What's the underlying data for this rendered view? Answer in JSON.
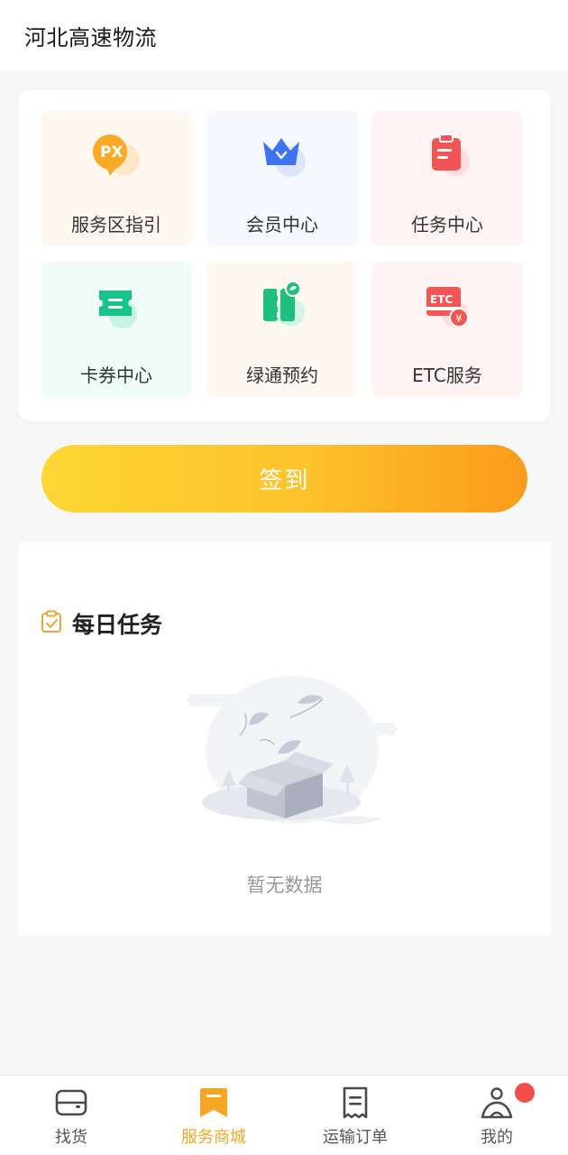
{
  "header": {
    "title": "河北高速物流"
  },
  "services": [
    {
      "label": "服务区指引",
      "icon": "px-location-icon"
    },
    {
      "label": "会员中心",
      "icon": "crown-icon"
    },
    {
      "label": "任务中心",
      "icon": "clipboard-icon"
    },
    {
      "label": "卡券中心",
      "icon": "ticket-icon"
    },
    {
      "label": "绿通预约",
      "icon": "green-road-icon"
    },
    {
      "label": "ETC服务",
      "icon": "etc-card-icon"
    }
  ],
  "checkin": {
    "label": "签到"
  },
  "daily_tasks": {
    "title": "每日任务",
    "empty_text": "暂无数据"
  },
  "tabbar": {
    "items": [
      {
        "label": "找货",
        "icon": "wallet-icon",
        "active": false
      },
      {
        "label": "服务商城",
        "icon": "bookmark-icon",
        "active": true
      },
      {
        "label": "运输订单",
        "icon": "receipt-icon",
        "active": false
      },
      {
        "label": "我的",
        "icon": "user-icon",
        "active": false
      }
    ]
  },
  "colors": {
    "accent": "#f5a623",
    "checkin_gradient_start": "#fdd635",
    "checkin_gradient_end": "#fb9b1b",
    "badge": "#f64b4b"
  }
}
